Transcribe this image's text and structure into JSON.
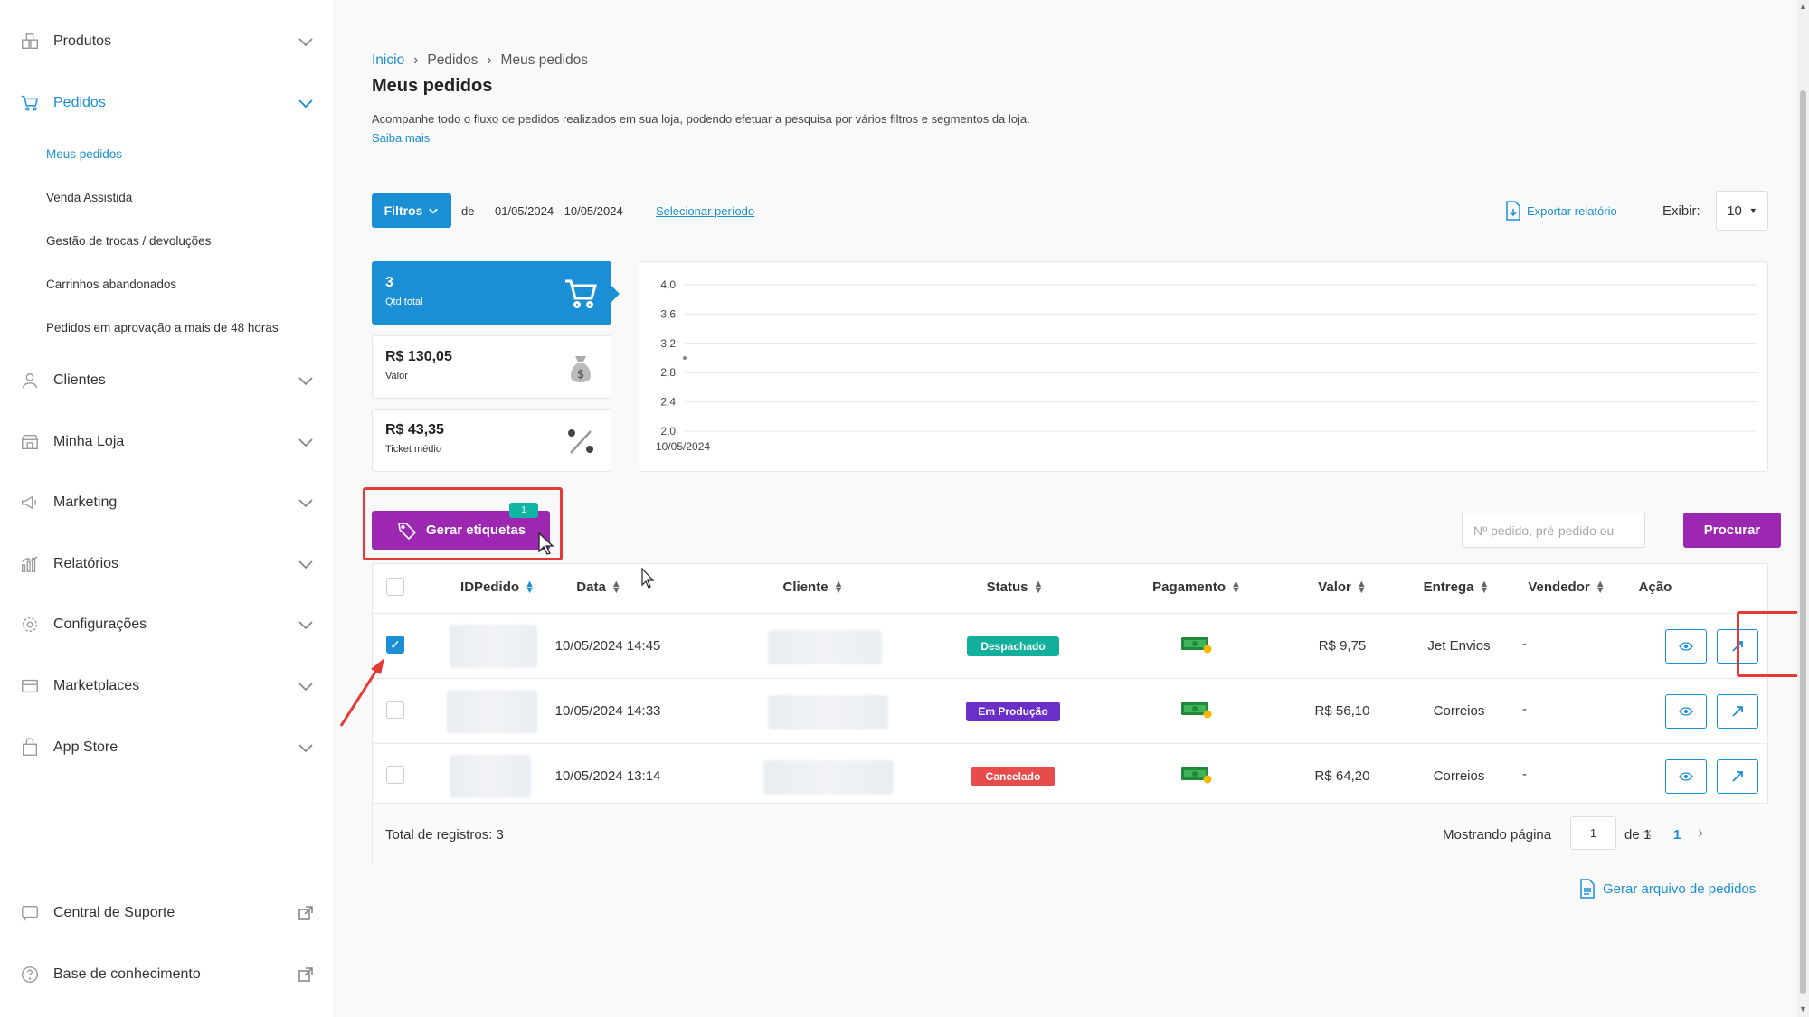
{
  "sidebar": {
    "items": [
      {
        "label": "Produtos",
        "icon": "box-icon"
      },
      {
        "label": "Pedidos",
        "icon": "cart-icon"
      },
      {
        "label": "Clientes",
        "icon": "user-icon"
      },
      {
        "label": "Minha Loja",
        "icon": "store-icon"
      },
      {
        "label": "Marketing",
        "icon": "megaphone-icon"
      },
      {
        "label": "Relatórios",
        "icon": "bar-chart-icon"
      },
      {
        "label": "Configurações",
        "icon": "gear-icon"
      },
      {
        "label": "Marketplaces",
        "icon": "marketplace-icon"
      },
      {
        "label": "App Store",
        "icon": "bag-icon"
      }
    ],
    "sub_items": [
      "Meus pedidos",
      "Venda Assistida",
      "Gestão de trocas / devoluções",
      "Carrinhos abandonados",
      "Pedidos em aprovação a mais de 48 horas"
    ],
    "bottom": [
      {
        "label": "Central de Suporte",
        "icon": "chat-icon"
      },
      {
        "label": "Base de conhecimento",
        "icon": "help-icon"
      }
    ]
  },
  "breadcrumb": {
    "home": "Inicio",
    "section": "Pedidos",
    "current": "Meus pedidos",
    "sep": "›"
  },
  "page": {
    "title": "Meus pedidos",
    "description": "Acompanhe todo o fluxo de pedidos realizados em sua loja, podendo efetuar a pesquisa por vários filtros e segmentos da loja.",
    "saiba_mais": "Saiba mais"
  },
  "toolbar": {
    "filtros": "Filtros",
    "de": "de",
    "periodo": "01/05/2024 - 10/05/2024",
    "selecionar_periodo": "Selecionar período",
    "exportar": "Exportar relatório",
    "exibir_label": "Exibir:",
    "exibir_value": "10"
  },
  "stats": {
    "qtd": {
      "value": "3",
      "caption": "Qtd total"
    },
    "valor": {
      "value": "R$ 130,05",
      "caption": "Valor"
    },
    "ticket": {
      "value": "R$ 43,35",
      "caption": "Ticket médio"
    }
  },
  "chart_data": {
    "type": "line",
    "categories": [
      "10/05/2024"
    ],
    "series": [
      {
        "values": [
          3
        ]
      }
    ],
    "yticks": [
      "4,0",
      "3,6",
      "3,2",
      "2,8",
      "2,4",
      "2,0"
    ],
    "ylim": [
      2.0,
      4.0
    ],
    "grid": true
  },
  "actions": {
    "gerar_etiquetas": "Gerar etiquetas",
    "badge": "1",
    "search_placeholder": "Nº pedido, pré-pedido ou",
    "procurar": "Procurar"
  },
  "table": {
    "headers": {
      "id": "IDPedido",
      "data": "Data",
      "cliente": "Cliente",
      "status": "Status",
      "pagamento": "Pagamento",
      "valor": "Valor",
      "entrega": "Entrega",
      "vendedor": "Vendedor",
      "acao": "Ação"
    },
    "rows": [
      {
        "checked": true,
        "data": "10/05/2024 14:45",
        "status": "Despachado",
        "status_color": "#12b09a",
        "valor": "R$ 9,75",
        "entrega": "Jet Envios",
        "vendedor": "-"
      },
      {
        "checked": false,
        "data": "10/05/2024 14:33",
        "status": "Em Produção",
        "status_color": "#6a2fc9",
        "valor": "R$ 56,10",
        "entrega": "Correios",
        "vendedor": "-"
      },
      {
        "checked": false,
        "data": "10/05/2024 13:14",
        "status": "Cancelado",
        "status_color": "#e74c4c",
        "valor": "R$ 64,20",
        "entrega": "Correios",
        "vendedor": "-"
      }
    ],
    "total": "Total de registros: 3",
    "mostrando": "Mostrando página",
    "page_input": "1",
    "de_total": "de 1",
    "current_page": "1"
  },
  "gerar_arquivo": "Gerar arquivo de pedidos",
  "colors": {
    "primary": "#1a8fd6",
    "purple": "#9c27b0",
    "highlight": "#e53935"
  }
}
